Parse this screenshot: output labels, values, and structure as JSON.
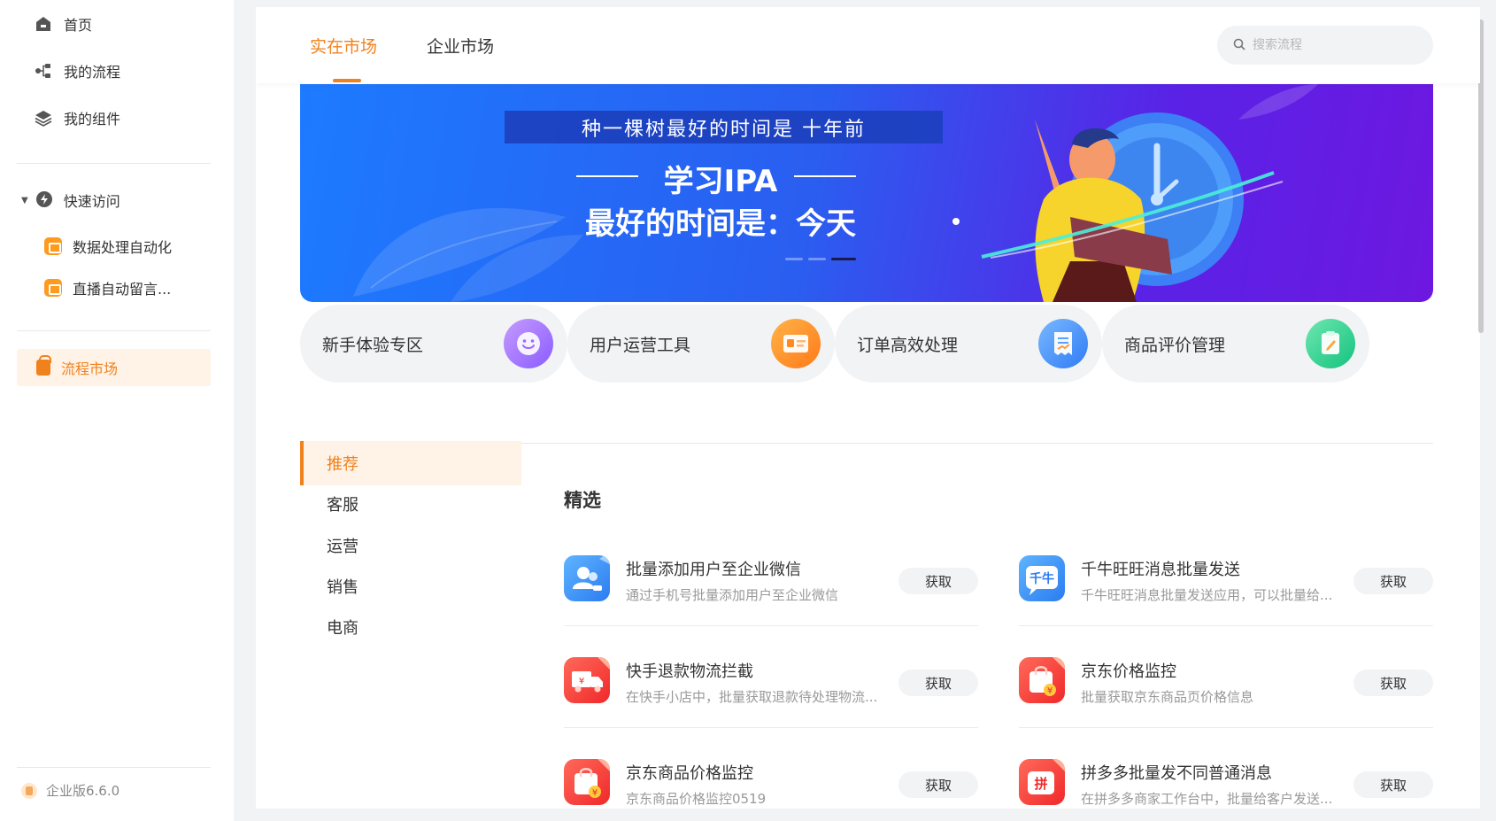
{
  "sidebar": {
    "nav": [
      {
        "label": "首页",
        "icon": "home-icon"
      },
      {
        "label": "我的流程",
        "icon": "flow-icon"
      },
      {
        "label": "我的组件",
        "icon": "layers-icon"
      }
    ],
    "quick_access": {
      "label": "快速访问",
      "items": [
        {
          "label": "数据处理自动化"
        },
        {
          "label": "直播自动留言..."
        }
      ]
    },
    "market": {
      "label": "流程市场"
    },
    "version": "企业版6.6.0"
  },
  "topbar": {
    "tabs": [
      {
        "label": "实在市场",
        "active": true
      },
      {
        "label": "企业市场",
        "active": false
      }
    ],
    "search_placeholder": "搜索流程"
  },
  "banner": {
    "headline": "种一棵树最好的时间是 十年前",
    "line1": "学习IPA",
    "line2": "最好的时间是：今天",
    "slide_count": 3,
    "active_slide": 3
  },
  "categories": [
    {
      "label": "新手体验专区",
      "icon": "smile-icon",
      "color": "#a875ff"
    },
    {
      "label": "用户运营工具",
      "icon": "id-card-icon",
      "color": "#ff8a1f"
    },
    {
      "label": "订单高效处理",
      "icon": "receipt-icon",
      "color": "#3d8bff"
    },
    {
      "label": "商品评价管理",
      "icon": "edit-note-icon",
      "color": "#1fcf8e"
    }
  ],
  "left_menu": [
    {
      "label": "推荐",
      "active": true
    },
    {
      "label": "客服",
      "active": false
    },
    {
      "label": "运营",
      "active": false
    },
    {
      "label": "销售",
      "active": false
    },
    {
      "label": "电商",
      "active": false
    }
  ],
  "section_title": "精选",
  "flows": [
    {
      "title": "批量添加用户至企业微信",
      "desc": "通过手机号批量添加用户至企业微信",
      "button": "获取",
      "icon": "wecom-users-icon"
    },
    {
      "title": "千牛旺旺消息批量发送",
      "desc": "千牛旺旺消息批量发送应用，可以批量给...",
      "button": "获取",
      "icon": "qianniu-icon"
    },
    {
      "title": "快手退款物流拦截",
      "desc": "在快手小店中，批量获取退款待处理物流...",
      "button": "获取",
      "icon": "refund-truck-icon"
    },
    {
      "title": "京东价格监控",
      "desc": "批量获取京东商品页价格信息",
      "button": "获取",
      "icon": "shopping-bag-icon"
    },
    {
      "title": "京东商品价格监控",
      "desc": "京东商品价格监控0519",
      "button": "获取",
      "icon": "shopping-bag-icon"
    },
    {
      "title": "拼多多批量发不同普通消息",
      "desc": "在拼多多商家工作台中，批量给客户发送...",
      "button": "获取",
      "icon": "pinduoduo-icon"
    }
  ],
  "colors": {
    "accent": "#f0821e",
    "accent_bg": "#fff2e6"
  }
}
